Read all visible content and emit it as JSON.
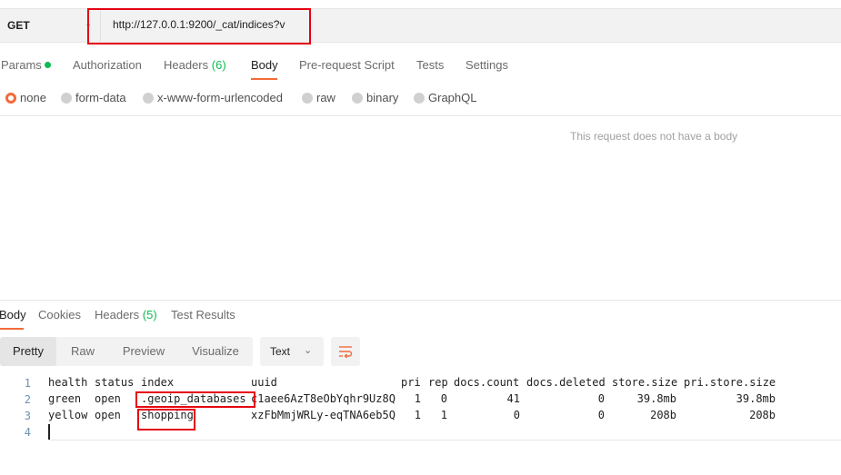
{
  "request": {
    "method": "GET",
    "url": "http://127.0.0.1:9200/_cat/indices?v"
  },
  "request_tabs": {
    "params": "Params",
    "authorization": "Authorization",
    "headers": "Headers",
    "headers_count": "(6)",
    "body": "Body",
    "prerequest": "Pre-request Script",
    "tests": "Tests",
    "settings": "Settings"
  },
  "body_types": {
    "none": "none",
    "form_data": "form-data",
    "urlencoded": "x-www-form-urlencoded",
    "raw": "raw",
    "binary": "binary",
    "graphql": "GraphQL"
  },
  "no_body_message": "This request does not have a body",
  "response_tabs": {
    "body": "Body",
    "cookies": "Cookies",
    "headers": "Headers",
    "headers_count": "(5)",
    "test_results": "Test Results"
  },
  "response_view": {
    "pretty": "Pretty",
    "raw": "Raw",
    "preview": "Preview",
    "visualize": "Visualize",
    "format": "Text"
  },
  "response_lines": {
    "line_numbers": [
      "1",
      "2",
      "3",
      "4"
    ],
    "header": [
      "health",
      "status",
      "index",
      "uuid",
      "pri",
      "rep",
      "docs.count",
      "docs.deleted",
      "store.size",
      "pri.store.size"
    ],
    "rows": [
      [
        "green",
        "open",
        ".geoip_databases",
        "c1aee6AzT8eObYqhr9Uz8Q",
        "1",
        "0",
        "41",
        "0",
        "39.8mb",
        "39.8mb"
      ],
      [
        "yellow",
        "open",
        "shopping",
        "xzFbMmjWRLy-eqTNA6eb5Q",
        "1",
        "1",
        "0",
        "0",
        "208b",
        "208b"
      ]
    ]
  },
  "colors": {
    "accent": "#f26b3a",
    "highlight_box": "#e60012",
    "status_green": "#0cbb52"
  }
}
